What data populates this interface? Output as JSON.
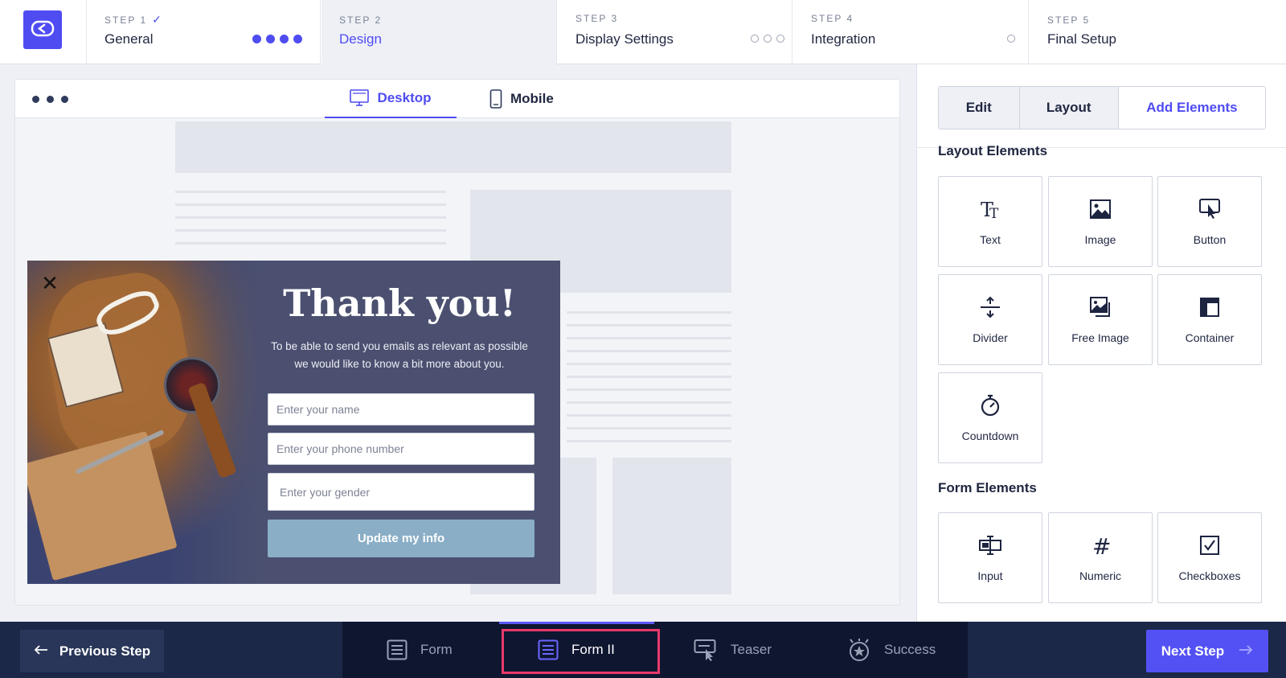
{
  "steps": [
    {
      "sub": "STEP 1",
      "name": "General",
      "state": "done",
      "dots": {
        "filled": 4,
        "empty": 0
      }
    },
    {
      "sub": "STEP 2",
      "name": "Design",
      "state": "active",
      "dots": {
        "filled": 0,
        "empty": 0
      }
    },
    {
      "sub": "STEP 3",
      "name": "Display Settings",
      "state": "pending",
      "dots": {
        "filled": 0,
        "empty": 3
      }
    },
    {
      "sub": "STEP 4",
      "name": "Integration",
      "state": "pending",
      "dots": {
        "filled": 0,
        "empty": 1
      }
    },
    {
      "sub": "STEP 5",
      "name": "Final Setup",
      "state": "pending",
      "dots": {
        "filled": 0,
        "empty": 0
      }
    }
  ],
  "check_mark": "✓",
  "preview": {
    "view_tabs": [
      {
        "label": "Desktop",
        "active": true
      },
      {
        "label": "Mobile",
        "active": false
      }
    ],
    "popup": {
      "title": "Thank you!",
      "text_line1": "To be able to send you emails as relevant as possible",
      "text_line2": "we would like to know a bit more about you.",
      "fields": [
        "Enter your name",
        "Enter your phone number",
        "Enter your gender"
      ],
      "cta": "Update my info"
    }
  },
  "panel": {
    "tabs": [
      {
        "label": "Edit",
        "active": false
      },
      {
        "label": "Layout",
        "active": false
      },
      {
        "label": "Add Elements",
        "active": true
      }
    ],
    "layout_title": "Layout Elements",
    "layout_elements": [
      {
        "label": "Text",
        "icon": "text-icon"
      },
      {
        "label": "Image",
        "icon": "image-icon"
      },
      {
        "label": "Button",
        "icon": "button-icon"
      },
      {
        "label": "Divider",
        "icon": "divider-icon"
      },
      {
        "label": "Free Image",
        "icon": "free-image-icon"
      },
      {
        "label": "Container",
        "icon": "container-icon"
      },
      {
        "label": "Countdown",
        "icon": "countdown-icon"
      }
    ],
    "form_title": "Form Elements",
    "form_elements": [
      {
        "label": "Input",
        "icon": "input-icon"
      },
      {
        "label": "Numeric",
        "icon": "numeric-icon"
      },
      {
        "label": "Checkboxes",
        "icon": "checkbox-icon"
      }
    ]
  },
  "bottom": {
    "prev": "Previous Step",
    "next": "Next Step",
    "tabs": [
      {
        "label": "Form",
        "active": false,
        "icon": "form-icon"
      },
      {
        "label": "Form II",
        "active": true,
        "icon": "form-icon"
      },
      {
        "label": "Teaser",
        "active": false,
        "icon": "teaser-icon"
      },
      {
        "label": "Success",
        "active": false,
        "icon": "success-icon"
      }
    ]
  },
  "colors": {
    "accent": "#4f4cf2",
    "bottom_bar": "#1c2848",
    "popup_bg": "#4b5070",
    "cta_bg": "#8aaec6",
    "highlight": "#e93a6c"
  }
}
